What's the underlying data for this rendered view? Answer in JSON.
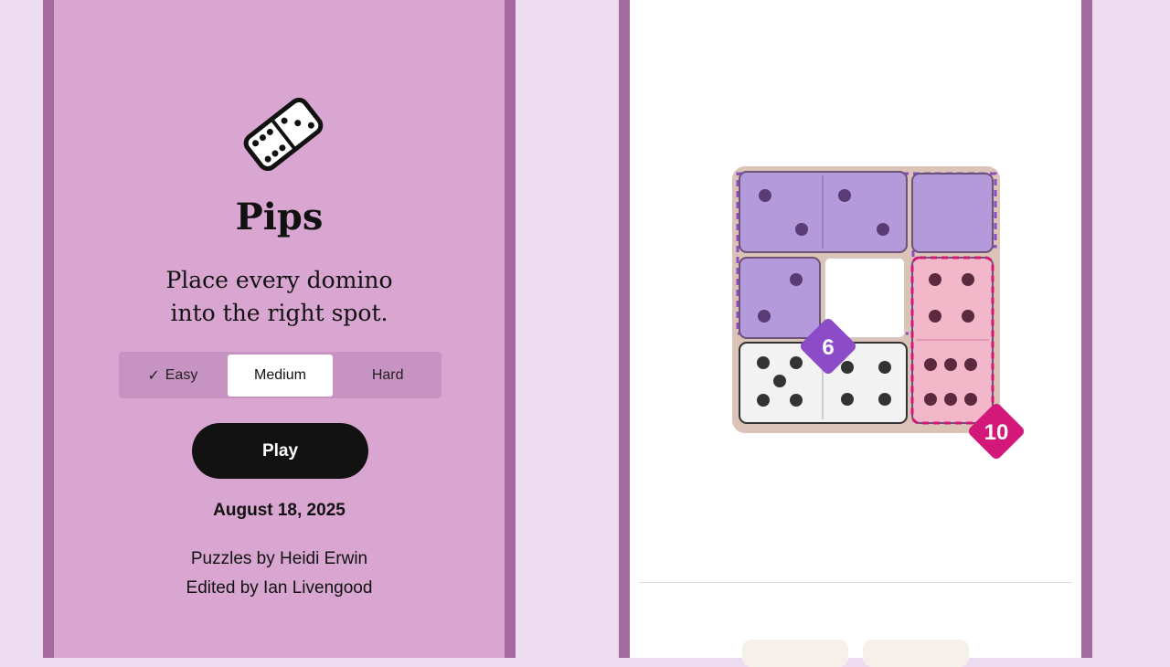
{
  "game": {
    "title": "Pips",
    "tagline_line1": "Place every domino",
    "tagline_line2": "into the right spot."
  },
  "difficulty": {
    "options": [
      {
        "label": "Easy",
        "completed": true
      },
      {
        "label": "Medium",
        "selected": true
      },
      {
        "label": "Hard"
      }
    ]
  },
  "play_button": {
    "label": "Play"
  },
  "date": "August 18, 2025",
  "credits": {
    "line1": "Puzzles by Heidi Erwin",
    "line2": "Edited by Ian Livengood"
  },
  "board": {
    "regions": [
      {
        "label": "6",
        "color": "#8c4bc7"
      },
      {
        "label": "10",
        "color": "#d4187a"
      }
    ]
  },
  "colors": {
    "phone_bg": "#d9a6d1",
    "frame": "#a46a9f",
    "page_bg": "#eddbf0",
    "purple_tile": "#b49ada",
    "pink_tile": "#f2b8c9"
  }
}
